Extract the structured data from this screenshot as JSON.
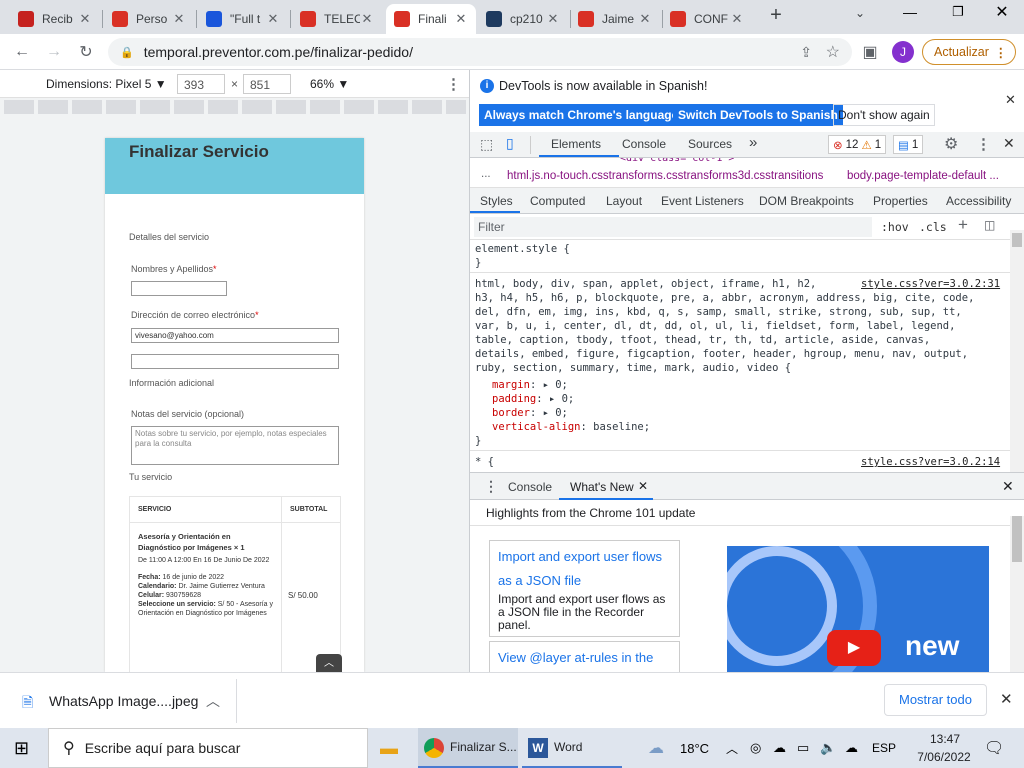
{
  "browser": {
    "tabs": [
      {
        "title": "Recib",
        "icon": "gmail-icon",
        "color": "#c5221f"
      },
      {
        "title": "Perso",
        "icon": "doc-icon",
        "color": "#d93025"
      },
      {
        "title": "\"Full t",
        "icon": "shield-icon",
        "color": "#1a56db"
      },
      {
        "title": "TELEC",
        "icon": "doc-icon",
        "color": "#d93025"
      },
      {
        "title": "Finali",
        "icon": "preventor-icon",
        "color": "#d93025",
        "active": true
      },
      {
        "title": "cp210",
        "icon": "cp-icon",
        "color": "#1e3a5f"
      },
      {
        "title": "Jaime",
        "icon": "w-icon",
        "color": "#d93025"
      },
      {
        "title": "CONF",
        "icon": "w-icon",
        "color": "#d93025"
      }
    ],
    "new_tab": "+",
    "url": "temporal.preventor.com.pe/finalizar-pedido/",
    "update_label": "Actualizar",
    "profile_initial": "J"
  },
  "emulation": {
    "dimensions_label": "Dimensions: Pixel 5 ▼",
    "width": "393",
    "times": "×",
    "height": "851",
    "zoom": "66% ▼"
  },
  "page": {
    "title": "Finalizar Servicio",
    "details_heading": "Detalles del servicio",
    "name_label": "Nombres y Apellidos",
    "email_label": "Dirección de correo electrónico",
    "email_value": "vivesano@yahoo.com",
    "additional_heading": "Información adicional",
    "notes_label": "Notas del servicio (opcional)",
    "notes_placeholder": "Notas sobre tu servicio, por ejemplo, notas especiales para la consulta",
    "your_service": "Tu servicio",
    "table": {
      "col_service": "SERVICIO",
      "col_subtotal": "SUBTOTAL",
      "service_name": "Asesoría y Orientación en Diagnóstico por Imágenes × 1",
      "schedule": "De 11:00 A 12:00 En 16 De Junio De 2022",
      "fecha_label": "Fecha:",
      "fecha_value": "16 de junio de 2022",
      "calendario_label": "Calendario:",
      "calendario_value": "Dr. Jaime Gutierrez Ventura",
      "celular_label": "Celular:",
      "celular_value": "930759628",
      "seleccione_label": "Seleccione un servicio:",
      "seleccione_value": "S/ 50 - Asesoría y Orientación en Diagnóstico por Imágenes",
      "subtotal": "S/ 50.00"
    }
  },
  "devtools": {
    "banner": "DevTools is now available in Spanish!",
    "btn_match": "Always match Chrome's language",
    "btn_switch": "Switch DevTools to Spanish",
    "btn_dont": "Don't show again",
    "main_tabs": [
      "Elements",
      "Console",
      "Sources"
    ],
    "errors": "12",
    "warnings": "1",
    "messages": "1",
    "breadcrumb_trunc": "<div class= col-1 >",
    "breadcrumb_ellipsis": "...",
    "breadcrumb_html": "html.js.no-touch.csstransforms.csstransforms3d.csstransitions",
    "breadcrumb_body": "body.page-template-default ...",
    "style_tabs": [
      "Styles",
      "Computed",
      "Layout",
      "Event Listeners",
      "DOM Breakpoints",
      "Properties",
      "Accessibility"
    ],
    "filter_placeholder": "Filter",
    "hov": ":hov",
    "cls": ".cls",
    "element_style": "element.style {",
    "close_brace": "}",
    "selector_lines": [
      "html, body, div, span, applet, object, iframe, h1, h2,",
      "h3, h4, h5, h6, p, blockquote, pre, a, abbr, acronym, address, big, cite, code,",
      "del, dfn, em, img, ins, kbd, q, s, samp, small, strike, strong, sub, sup, tt,",
      "var, b, u, i, center, dl, dt, dd, ol, ul, li, fieldset, form, label, legend,",
      "table, caption, tbody, tfoot, thead, tr, th, td, article, aside, canvas,",
      "details, embed, figure, figcaption, footer, header, hgroup, menu, nav, output,",
      "ruby, section, summary, time, mark, audio, video {"
    ],
    "source_link": "style.css?ver=3.0.2:31",
    "source_link2": "style.css?ver=3.0.2:14",
    "props": [
      {
        "name": "margin",
        "value": "0;"
      },
      {
        "name": "padding",
        "value": "0;"
      },
      {
        "name": "border",
        "value": "0;"
      },
      {
        "name": "vertical-align",
        "value": "baseline;"
      }
    ],
    "star_rule": "* {",
    "drawer_tabs": [
      "Console",
      "What's New"
    ],
    "highlights": "Highlights from the Chrome 101 update",
    "card1_title": "Import and export user flows as a JSON file",
    "card1_body": "Import and export user flows as a JSON file in the Recorder panel.",
    "card2_title": "View @layer at-rules in the",
    "video_text": "new"
  },
  "download": {
    "file": "WhatsApp Image....jpeg",
    "show_all": "Mostrar todo"
  },
  "taskbar": {
    "search_placeholder": "Escribe aquí para buscar",
    "chrome_label": "Finalizar S...",
    "word_label": "Word",
    "temperature": "18°C",
    "lang": "ESP",
    "time": "13:47",
    "date": "7/06/2022"
  }
}
